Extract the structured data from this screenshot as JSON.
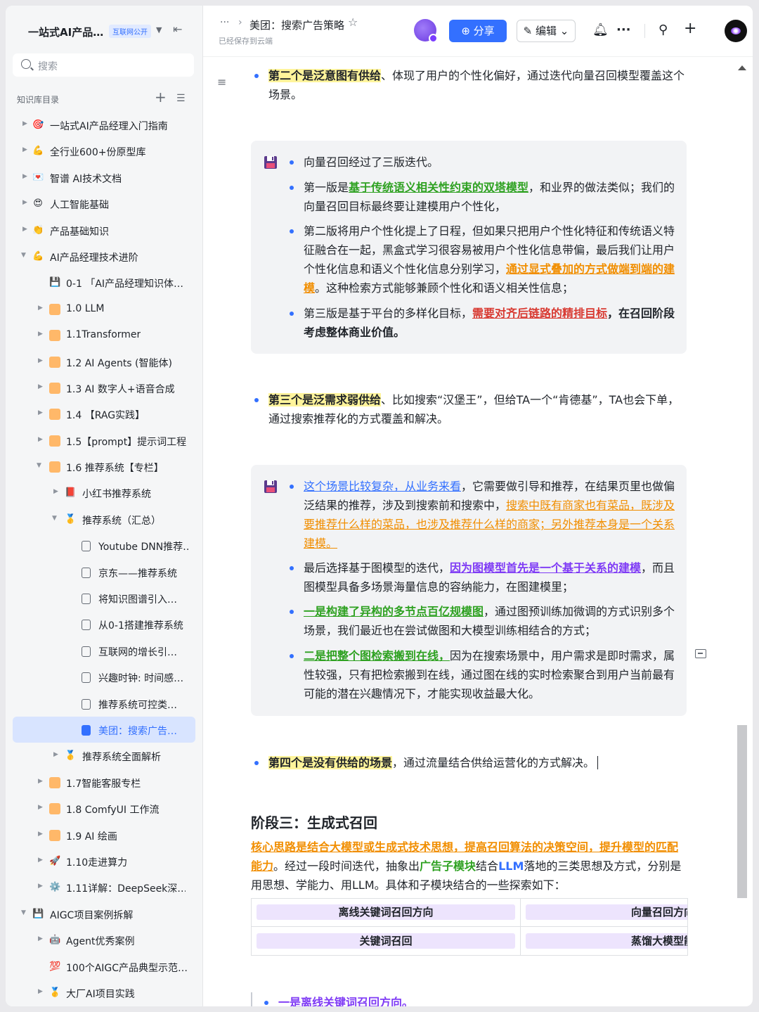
{
  "sidebar": {
    "title": "一站式AI产品…",
    "badge": "互联网公开",
    "search_placeholder": "搜索",
    "toc_label": "知识库目录",
    "items": [
      {
        "label": "一站式AI产品经理入门指南",
        "icon": "🎯"
      },
      {
        "label": "全行业600+份原型库",
        "icon": "💪"
      },
      {
        "label": "智谱 AI技术文档",
        "icon": "💌"
      },
      {
        "label": "人工智能基础",
        "icon": "😍"
      },
      {
        "label": "产品基础知识",
        "icon": "👏"
      },
      {
        "label": "AI产品经理技术进阶",
        "icon": "💪"
      },
      {
        "label": "0-1 「AI产品经理知识体…",
        "icon": "💾"
      },
      {
        "label": "1.0 LLM",
        "icon": "🤖"
      },
      {
        "label": "1.1Transformer",
        "icon": "🔶"
      },
      {
        "label": "1.2 AI Agents (智能体)",
        "icon": "🔶"
      },
      {
        "label": "1.3 AI 数字人+语音合成",
        "icon": "🔶"
      },
      {
        "label": "1.4 【RAG实践】",
        "icon": "🔶"
      },
      {
        "label": "1.5【prompt】提示词工程",
        "icon": "🔶"
      },
      {
        "label": "1.6 推荐系统【专栏】",
        "icon": "🔶"
      },
      {
        "label": "小红书推荐系统",
        "icon": "📕"
      },
      {
        "label": "推荐系统（汇总）",
        "icon": "🥇"
      },
      {
        "label": "Youtube DNN推荐…",
        "icon": "doc"
      },
      {
        "label": "京东——推荐系统",
        "icon": "doc"
      },
      {
        "label": "将知识图谱引入…",
        "icon": "doc"
      },
      {
        "label": "从0-1搭建推荐系统",
        "icon": "doc"
      },
      {
        "label": "互联网的增长引…",
        "icon": "doc"
      },
      {
        "label": "兴趣时钟: 时间感…",
        "icon": "doc"
      },
      {
        "label": "推荐系统可控类…",
        "icon": "doc"
      },
      {
        "label": "美团：搜索广告…",
        "icon": "doc"
      },
      {
        "label": "推荐系统全面解析",
        "icon": "🥇"
      },
      {
        "label": "1.7智能客服专栏",
        "icon": "🔶"
      },
      {
        "label": "1.8 ComfyUI 工作流",
        "icon": "🔶"
      },
      {
        "label": "1.9 AI 绘画",
        "icon": "🔶"
      },
      {
        "label": "1.10走进算力",
        "icon": "🚀"
      },
      {
        "label": "1.11详解：DeepSeek深…",
        "icon": "⚙️"
      },
      {
        "label": "AIGC项目案例拆解",
        "icon": "💾"
      },
      {
        "label": "Agent优秀案例",
        "icon": "🤖"
      },
      {
        "label": "100个AIGC产品典型示范…",
        "icon": "💯"
      },
      {
        "label": "大厂AI项目实践",
        "icon": "🥇"
      }
    ]
  },
  "header": {
    "crumb_dots": "···",
    "crumb_sep": "›",
    "doc_title": "美团：搜索广告策略",
    "saved_status": "已经保存到云端",
    "share_label": "分享",
    "edit_label": "编辑"
  },
  "content": {
    "p1_hl": "第二个是泛意图有供给",
    "p1_rest": "、体现了用户的个性化偏好，通过迭代向量召回模型覆盖这个场景。",
    "c1_l1": "向量召回经过了三版迭代。",
    "c1_l2_a": "第一版是",
    "c1_l2_b": "基于传统语义相关性约束的双塔模型",
    "c1_l2_c": "，和业界的做法类似；我们的向量召回目标最终要让建模用户个性化，",
    "c1_l3_a": "第二版将用户个性化提上了日程，但如果只把用户个性化特征和传统语义特征融合在一起，黑盒式学习很容易被用户个性化信息带偏，最后我们让用户个性化信息和语义个性化信息分别学习，",
    "c1_l3_b": "通过显式叠加的方式做端到端的建模",
    "c1_l3_c": "。这种检索方式能够兼顾个性化和语义相关性信息；",
    "c1_l4_a": "第三版是基于平台的多样化目标，",
    "c1_l4_b": "需要对齐后链路的精排目标",
    "c1_l4_c": "，在召回阶段考虑整体商业价值。",
    "p2_hl": "第三个是泛需求弱供给",
    "p2_rest": "、比如搜索“汉堡王”，但给TA一个“肯德基”，TA也会下单，通过搜索推荐化的方式覆盖和解决。",
    "c2_l1_a": "这个场景比较复杂，从业务来看",
    "c2_l1_b": "，它需要做引导和推荐，在结果页里也做偏泛结果的推荐，涉及到搜索前和搜索中，",
    "c2_l1_c": "搜索中既有商家也有菜品，既涉及要推荐什么样的菜品，也涉及推荐什么样的商家；另外推荐本身是一个关系建模。",
    "c2_l2_a": "最后选择基于图模型的迭代，",
    "c2_l2_b": "因为图模型首先是一个基于关系的建模",
    "c2_l2_c": "，而且图模型具备多场景海量信息的容纳能力，在图建模里；",
    "c2_l3_a": "一是构建了异构的多节点百亿规模图",
    "c2_l3_b": "，通过图预训练加微调的方式识别多个场景，我们最近也在尝试做图和大模型训练相结合的方式；",
    "c2_l4_a": "二是把整个图检索搬到在线，",
    "c2_l4_b": "因为在搜索场景中，用户需求是即时需求，属性较强，只有把检索搬到在线，通过图在线的实时检索聚合到用户当前最有可能的潜在兴趣情况下，才能实现收益最大化。",
    "p3_hl": "第四个是没有供给的场景",
    "p3_rest": "，通过流量结合供给运营化的方式解决。",
    "h2": "阶段三：生成式召回",
    "p4_a": "核心思路是结合大模型或生成式技术思想，提高召回算法的决策空间，提升模型的匹配能力",
    "p4_b": "。经过一段时间迭代，抽象出",
    "p4_c": "广告子模块",
    "p4_d": "结合",
    "p4_e": "LLM",
    "p4_f": "落地的三类思想及方式，分别是用思想、学能力、用LLM。具体和子模块结合的一些探索如下：",
    "table": {
      "r1c1": "离线关键词召回方向",
      "r1c2": "向量召回方向",
      "r2c1": "关键词召回",
      "r2c2": "蒸馏大模型能"
    },
    "last_bullet": "一是离线关键词召回方向。"
  },
  "colors": {
    "accent": "#3370ff",
    "highlight": "#fff49b",
    "green": "#2ea121",
    "orange": "#f18e00",
    "red": "#d83931",
    "purple": "#7f3bf5"
  }
}
